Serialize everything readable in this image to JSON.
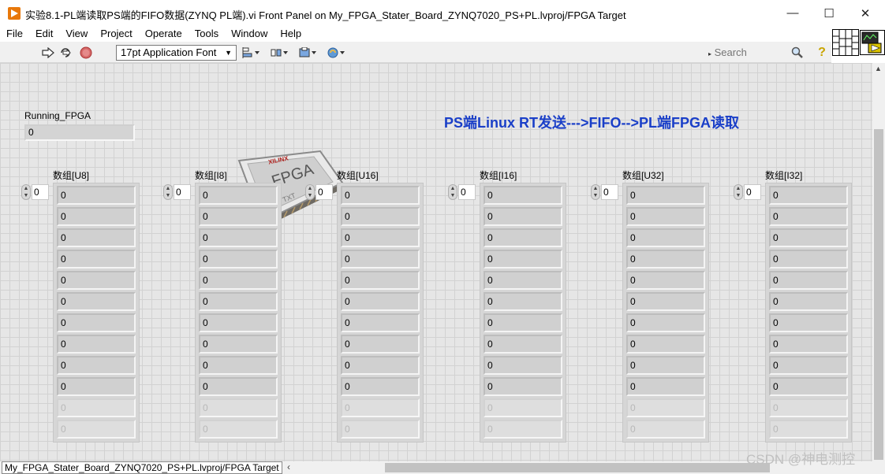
{
  "window": {
    "title": "实验8.1-PL端读取PS端的FIFO数据(ZYNQ PL端).vi Front Panel on My_FPGA_Stater_Board_ZYNQ7020_PS+PL.lvproj/FPGA Target",
    "minimize": "—",
    "maximize": "☐",
    "close": "✕"
  },
  "menu": [
    "File",
    "Edit",
    "View",
    "Project",
    "Operate",
    "Tools",
    "Window",
    "Help"
  ],
  "toolbar": {
    "font": "17pt Application Font",
    "search_placeholder": "Search",
    "help_glyph": "?"
  },
  "panel": {
    "running": {
      "label": "Running_FPGA",
      "value": "0"
    },
    "heading": "PS端Linux RT发送--->FIFO-->PL端FPGA读取",
    "chip": {
      "brand": "XILINX",
      "text": "FPGA",
      "sub": "TXT"
    },
    "arrays": [
      {
        "label": "数组[U8]",
        "index": "0",
        "values": [
          "0",
          "0",
          "0",
          "0",
          "0",
          "0",
          "0",
          "0",
          "0",
          "0",
          "0",
          "0"
        ]
      },
      {
        "label": "数组[I8]",
        "index": "0",
        "values": [
          "0",
          "0",
          "0",
          "0",
          "0",
          "0",
          "0",
          "0",
          "0",
          "0",
          "0",
          "0"
        ]
      },
      {
        "label": "数组[U16]",
        "index": "0",
        "values": [
          "0",
          "0",
          "0",
          "0",
          "0",
          "0",
          "0",
          "0",
          "0",
          "0",
          "0",
          "0"
        ]
      },
      {
        "label": "数组[I16]",
        "index": "0",
        "values": [
          "0",
          "0",
          "0",
          "0",
          "0",
          "0",
          "0",
          "0",
          "0",
          "0",
          "0",
          "0"
        ]
      },
      {
        "label": "数组[U32]",
        "index": "0",
        "values": [
          "0",
          "0",
          "0",
          "0",
          "0",
          "0",
          "0",
          "0",
          "0",
          "0",
          "0",
          "0"
        ]
      },
      {
        "label": "数组[I32]",
        "index": "0",
        "values": [
          "0",
          "0",
          "0",
          "0",
          "0",
          "0",
          "0",
          "0",
          "0",
          "0",
          "0",
          "0"
        ]
      }
    ]
  },
  "status": {
    "path": "My_FPGA_Stater_Board_ZYNQ7020_PS+PL.lvproj/FPGA Target"
  },
  "watermark": "CSDN @神电测控",
  "colors": {
    "heading": "#1a3fc8",
    "app_icon": "#e8780a",
    "abort_button": "#c84040"
  }
}
